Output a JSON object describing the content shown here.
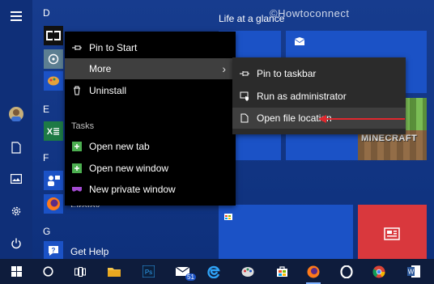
{
  "watermark": "©Howtoconnect",
  "tiles": {
    "group_title": "Life at a glance",
    "minecraft_label": "MINECRAFT"
  },
  "applist": {
    "letters": [
      "D",
      "E",
      "F",
      "G"
    ],
    "firefox_partial": "Firefox",
    "get_help": "Get Help"
  },
  "context_menu": {
    "pin_to_start": "Pin to Start",
    "more": "More",
    "uninstall": "Uninstall",
    "tasks_header": "Tasks",
    "open_new_tab": "Open new tab",
    "open_new_window": "Open new window",
    "new_private_window": "New private window"
  },
  "submenu": {
    "pin_to_taskbar": "Pin to taskbar",
    "run_as_admin": "Run as administrator",
    "open_file_location": "Open file location"
  },
  "taskbar": {
    "mail_badge": "51"
  },
  "colors": {
    "accent": "#1b52c6",
    "highlight_arrow": "#e0282e",
    "red_tile": "#d9383d"
  }
}
